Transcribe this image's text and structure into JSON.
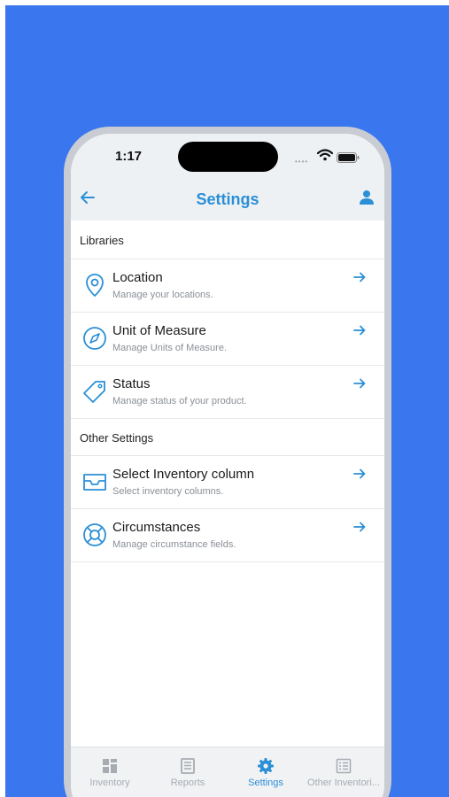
{
  "status_bar": {
    "time": "1:17"
  },
  "header": {
    "title": "Settings"
  },
  "sections": [
    {
      "title": "Libraries",
      "items": [
        {
          "icon": "location-pin-icon",
          "label": "Location",
          "subtitle": "Manage your locations."
        },
        {
          "icon": "compass-icon",
          "label": "Unit of Measure",
          "subtitle": "Manage Units of Measure."
        },
        {
          "icon": "tag-icon",
          "label": "Status",
          "subtitle": "Manage status of your product."
        }
      ]
    },
    {
      "title": "Other Settings",
      "items": [
        {
          "icon": "inbox-tray-icon",
          "label": "Select Inventory column",
          "subtitle": "Select inventory columns."
        },
        {
          "icon": "lifebuoy-icon",
          "label": "Circumstances",
          "subtitle": "Manage circumstance fields."
        }
      ]
    }
  ],
  "tabs": [
    {
      "icon": "grid-icon",
      "label": "Inventory",
      "active": false
    },
    {
      "icon": "document-icon",
      "label": "Reports",
      "active": false
    },
    {
      "icon": "gear-icon",
      "label": "Settings",
      "active": true
    },
    {
      "icon": "list-icon",
      "label": "Other Inventori..."
    }
  ],
  "colors": {
    "accent": "#2b8fd6",
    "background": "#3a76ee",
    "inactive_tab": "#a7acb2"
  }
}
